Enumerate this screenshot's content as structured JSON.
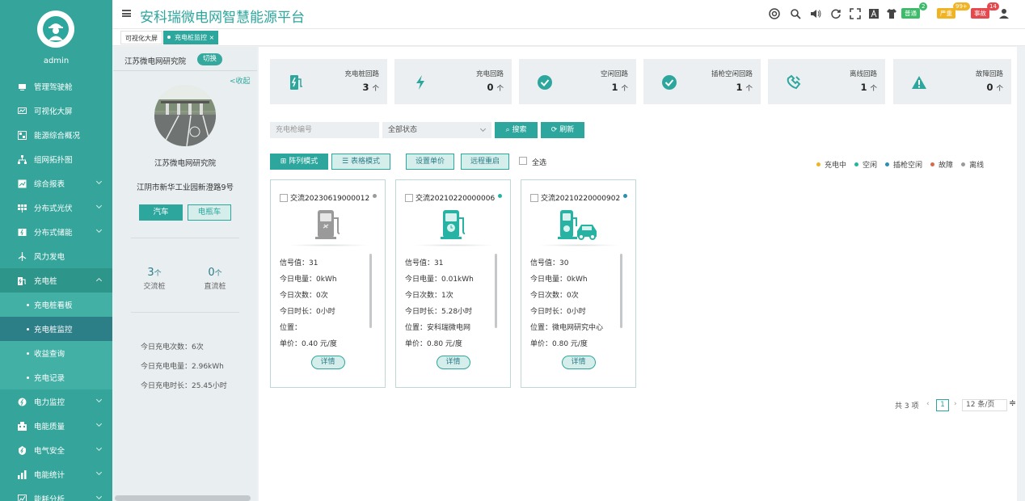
{
  "header": {
    "title": "安科瑞微电网智慧能源平台",
    "badge_prompt": "普通",
    "badge_prompt_count": "2",
    "badge_serious": "严重",
    "badge_serious_count": "99+",
    "badge_accident": "事故",
    "badge_accident_count": "14"
  },
  "tabs": [
    {
      "label": "可视化大屏"
    },
    {
      "label": "充电桩监控",
      "close": "×"
    }
  ],
  "sidebar": {
    "username": "admin",
    "items": [
      {
        "label": "管理驾驶舱"
      },
      {
        "label": "可视化大屏"
      },
      {
        "label": "能源综合概况"
      },
      {
        "label": "组网拓扑图"
      },
      {
        "label": "综合报表"
      },
      {
        "label": "分布式光伏"
      },
      {
        "label": "分布式储能"
      },
      {
        "label": "风力发电"
      },
      {
        "label": "充电桩"
      },
      {
        "label": "电力监控"
      },
      {
        "label": "电能质量"
      },
      {
        "label": "电气安全"
      },
      {
        "label": "电能统计"
      },
      {
        "label": "能耗分析"
      }
    ],
    "subitems": [
      {
        "label": "充电桩看板"
      },
      {
        "label": "充电桩监控"
      },
      {
        "label": "收益查询"
      },
      {
        "label": "充电记录"
      }
    ]
  },
  "left_panel": {
    "org": "江苏微电网研究院",
    "switch": "切换",
    "collapse": "<收起",
    "site_name": "江苏微电网研究院",
    "address": "江阴市新华工业园新澄路9号",
    "btn_car": "汽车",
    "btn_ebike": "电瓶车",
    "ac_count": "3",
    "ac_unit": "个",
    "ac_label": "交流桩",
    "dc_count": "0",
    "dc_unit": "个",
    "dc_label": "直流桩",
    "today_times": "今日充电次数：6次",
    "today_energy": "今日充电电量：2.96kWh",
    "today_duration": "今日充电时长：25.45小时"
  },
  "summary_cards": [
    {
      "label": "充电桩回路",
      "value": "3",
      "unit": "个"
    },
    {
      "label": "充电回路",
      "value": "0",
      "unit": "个"
    },
    {
      "label": "空闲回路",
      "value": "1",
      "unit": "个"
    },
    {
      "label": "插枪空闲回路",
      "value": "1",
      "unit": "个"
    },
    {
      "label": "离线回路",
      "value": "1",
      "unit": "个"
    },
    {
      "label": "故障回路",
      "value": "0",
      "unit": "个"
    }
  ],
  "filters": {
    "code_placeholder": "充电枪编号",
    "status_value": "全部状态",
    "search": "搜索",
    "refresh": "刷新"
  },
  "toolbar": {
    "array_mode": "阵列模式",
    "table_mode": "表格模式",
    "set_price": "设置单价",
    "remote_restart": "远程重启",
    "select_all": "全选"
  },
  "legend": [
    {
      "label": "充电中",
      "color": "#f0b323"
    },
    {
      "label": "空闲",
      "color": "#26b3a4"
    },
    {
      "label": "插枪空闲",
      "color": "#2a8fb0"
    },
    {
      "label": "故障",
      "color": "#d9694a"
    },
    {
      "label": "离线",
      "color": "#9a9a9a"
    }
  ],
  "piles": [
    {
      "id": "交流20230619000012",
      "status_color": "#9a9a9a",
      "signal": "信号值：31",
      "energy": "今日电量：0kWh",
      "times": "今日次数：0次",
      "duration": "今日时长：0小时",
      "location": "位置：",
      "price": "单价：0.40 元/度",
      "detail": "详情"
    },
    {
      "id": "交流20210220000006",
      "status_color": "#26b3a4",
      "signal": "信号值：31",
      "energy": "今日电量：0.01kWh",
      "times": "今日次数：1次",
      "duration": "今日时长：5.28小时",
      "location": "位置：安科瑞微电网",
      "price": "单价：0.80 元/度",
      "detail": "详情"
    },
    {
      "id": "交流20210220000902",
      "status_color": "#2a8fb0",
      "signal": "信号值：30",
      "energy": "今日电量：0kWh",
      "times": "今日次数：0次",
      "duration": "今日时长：0小时",
      "location": "位置：微电网研究中心",
      "price": "单价：0.80 元/度",
      "detail": "详情"
    }
  ],
  "pagination": {
    "total": "共 3 项",
    "page": "1",
    "page_size": "12 条/页"
  }
}
